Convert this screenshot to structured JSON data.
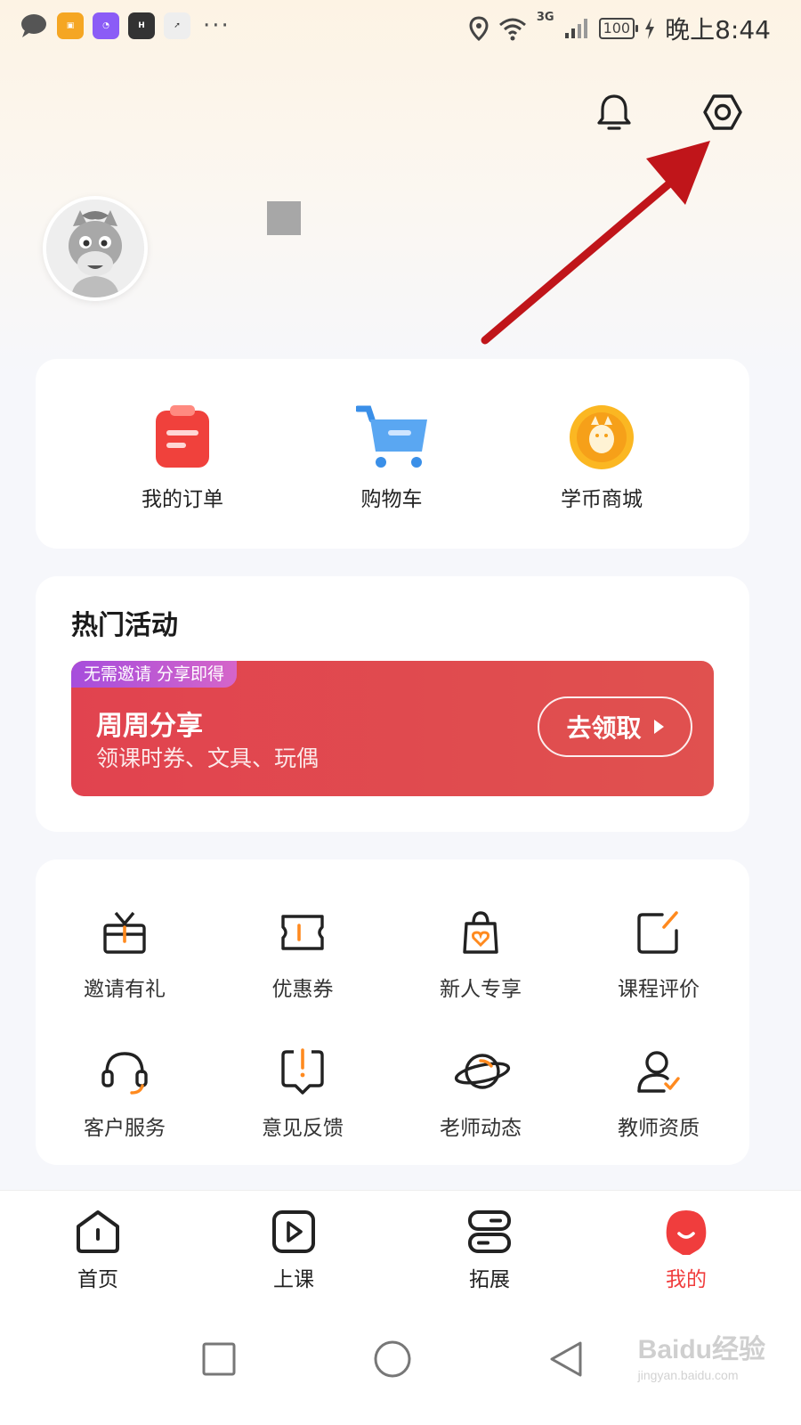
{
  "status_bar": {
    "network": "3G",
    "battery": "100",
    "time": "晚上8:44",
    "app_icons": [
      "message-icon",
      "box-icon",
      "pie-app-icon",
      "huawei-icon",
      "compass-icon"
    ]
  },
  "header": {
    "notification_icon": "bell-icon",
    "settings_icon": "settings-hex-icon"
  },
  "profile": {
    "avatar_icon": "horse-avatar-icon"
  },
  "quick_links": [
    {
      "label": "我的订单",
      "icon": "order-clipboard-icon"
    },
    {
      "label": "购物车",
      "icon": "shopping-cart-icon"
    },
    {
      "label": "学币商城",
      "icon": "coin-mall-icon"
    }
  ],
  "hot_activity": {
    "title": "热门活动",
    "banner": {
      "tag": "无需邀请 分享即得",
      "title": "周周分享",
      "subtitle": "领课时券、文具、玩偶",
      "button": "去领取"
    }
  },
  "services": [
    {
      "label": "邀请有礼",
      "icon": "gift-icon"
    },
    {
      "label": "优惠券",
      "icon": "coupon-icon"
    },
    {
      "label": "新人专享",
      "icon": "new-user-bag-icon"
    },
    {
      "label": "课程评价",
      "icon": "edit-review-icon"
    },
    {
      "label": "客户服务",
      "icon": "headset-icon"
    },
    {
      "label": "意见反馈",
      "icon": "feedback-icon"
    },
    {
      "label": "老师动态",
      "icon": "planet-icon"
    },
    {
      "label": "教师资质",
      "icon": "teacher-badge-icon"
    }
  ],
  "bottom_nav": [
    {
      "label": "首页",
      "icon": "home-icon",
      "active": false
    },
    {
      "label": "上课",
      "icon": "play-class-icon",
      "active": false
    },
    {
      "label": "拓展",
      "icon": "expand-icon",
      "active": false
    },
    {
      "label": "我的",
      "icon": "me-icon",
      "active": true
    }
  ],
  "watermark": {
    "brand": "Baidu经验",
    "url": "jingyan.baidu.com"
  },
  "colors": {
    "accent_red": "#f03d3d",
    "accent_orange": "#ff8a1f",
    "banner_red": "#e1434f",
    "tag_purple": "#a64ddc",
    "annotation_arrow": "#c0151a"
  }
}
